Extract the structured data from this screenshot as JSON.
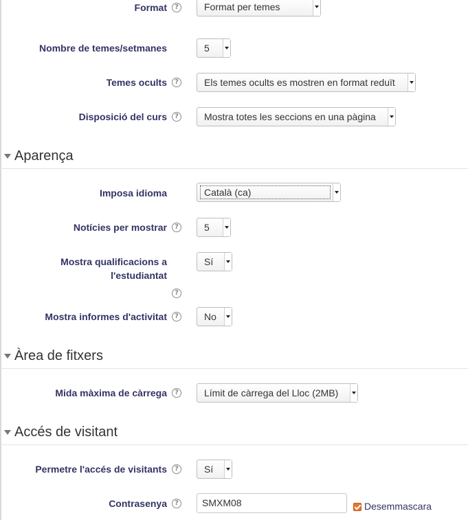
{
  "help_glyph": "?",
  "general_fields": [
    {
      "label": "Format",
      "value": "Format per temes"
    },
    {
      "label": "Nombre de temes/setmanes",
      "value": "5"
    },
    {
      "label": "Temes ocults",
      "value": "Els temes ocults es mostren en format reduït"
    },
    {
      "label": "Disposició del curs",
      "value": "Mostra totes les seccions en una pàgina"
    }
  ],
  "sections": {
    "appearance": {
      "title": "Aparença",
      "fields": [
        {
          "label": "Imposa idioma",
          "value": "Català (ca)"
        },
        {
          "label": "Notícies per mostrar",
          "value": "5"
        },
        {
          "label_line1": "Mostra qualificacions a",
          "label_line2": "l'estudiantat",
          "value": "Sí"
        },
        {
          "label": "Mostra informes d'activitat",
          "value": "No"
        }
      ]
    },
    "files": {
      "title": "Àrea de fitxers",
      "fields": [
        {
          "label": "Mida màxima de càrrega",
          "value": "Límit de càrrega del Lloc (2MB)"
        }
      ]
    },
    "guest": {
      "title": "Accés de visitant",
      "fields": [
        {
          "label": "Permetre l'accés de visitants",
          "value": "Sí"
        },
        {
          "label": "Contrasenya",
          "value": "SMXM08",
          "unmask_label": "Desemmascara",
          "unmask_checked": true
        }
      ]
    }
  },
  "colors": {
    "label": "#333366",
    "accent_checkbox": "#e8762b"
  }
}
